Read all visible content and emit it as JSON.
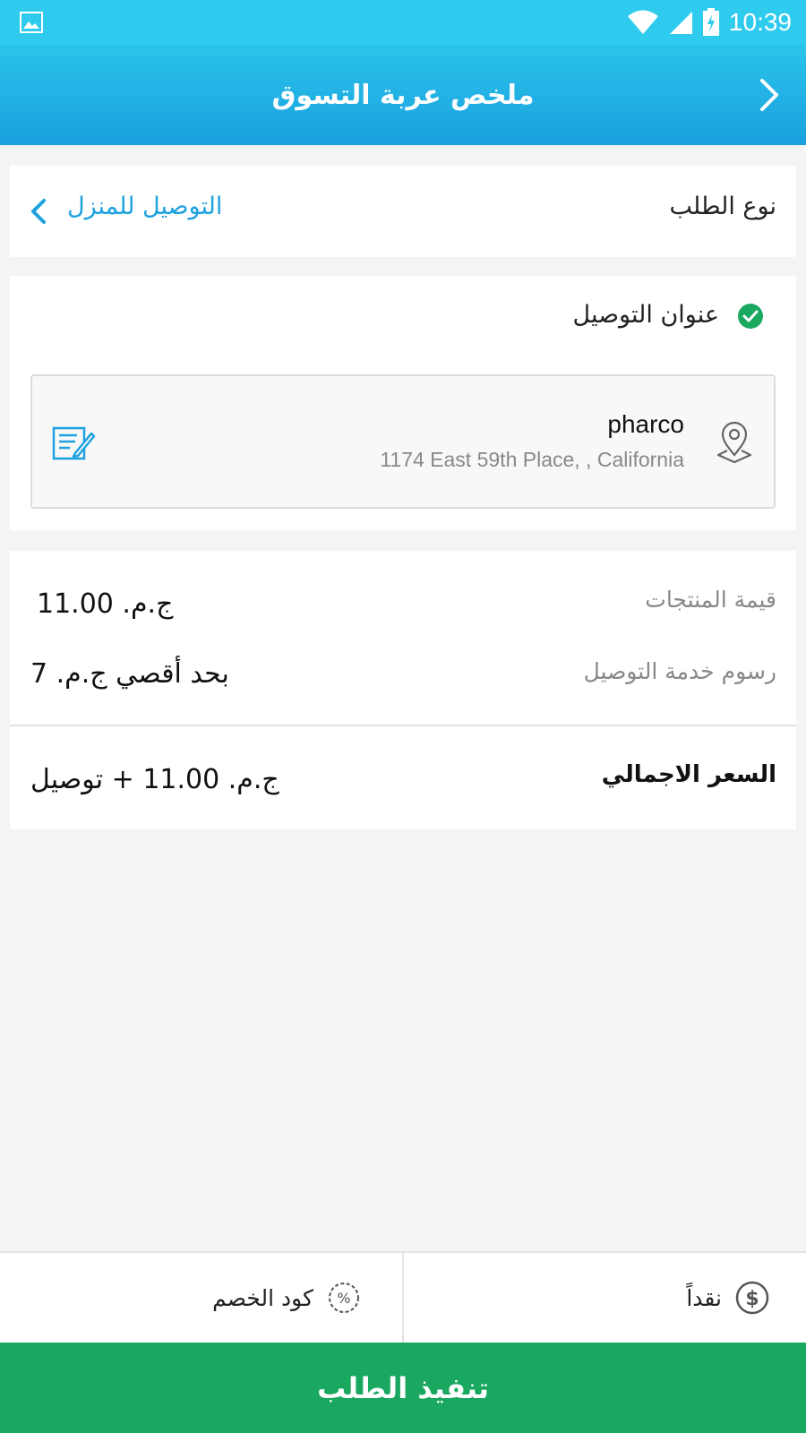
{
  "status_bar": {
    "time": "10:39"
  },
  "app_bar": {
    "title": "ملخص عربة التسوق"
  },
  "order_type": {
    "label": "نوع الطلب",
    "value": "التوصيل للمنزل"
  },
  "address": {
    "section_title": "عنوان التوصيل",
    "name": "pharco",
    "line": "1174 East 59th Place, , California"
  },
  "pricing": {
    "products_label": "قيمة المنتجات",
    "products_value": "ج.م. 11.00",
    "delivery_label": "رسوم خدمة التوصيل",
    "delivery_value": "بحد أقصي ج.م. 7",
    "total_label": "السعر الاجمالي",
    "total_value": "ج.م. 11.00 + توصيل"
  },
  "bottom_bar": {
    "payment_label": "نقداً",
    "discount_label": "كود الخصم"
  },
  "submit_label": "تنفيذ الطلب",
  "colors": {
    "header": "#1da1de",
    "accent_text": "#1da1de",
    "check": "#1aa861",
    "submit": "#1aa861"
  }
}
